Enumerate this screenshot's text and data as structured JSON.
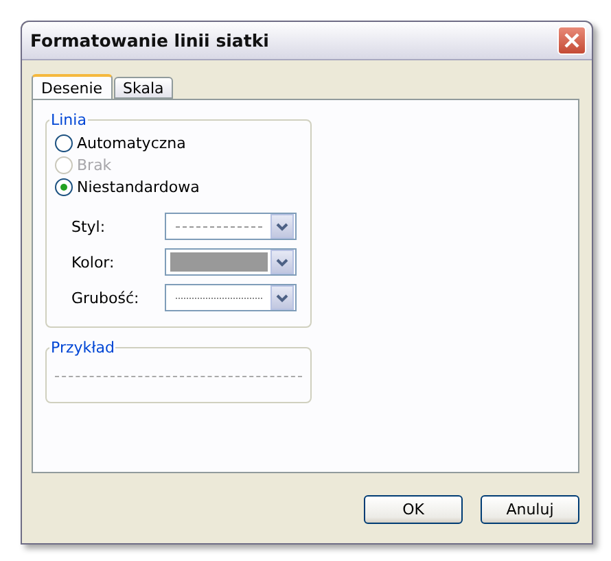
{
  "window": {
    "title": "Formatowanie linii siatki"
  },
  "tabs": [
    {
      "label": "Desenie",
      "selected": true
    },
    {
      "label": "Skala",
      "selected": false
    }
  ],
  "line_group": {
    "title": "Linia",
    "options": [
      {
        "label": "Automatyczna",
        "selected": false,
        "disabled": false
      },
      {
        "label": "Brak",
        "selected": false,
        "disabled": true
      },
      {
        "label": "Niestandardowa",
        "selected": true,
        "disabled": false
      }
    ],
    "fields": [
      {
        "label": "Styl:",
        "kind": "dashed"
      },
      {
        "label": "Kolor:",
        "kind": "color",
        "color": "#999999"
      },
      {
        "label": "Grubość:",
        "kind": "thin"
      }
    ]
  },
  "sample_group": {
    "title": "Przykład"
  },
  "buttons": [
    "OK",
    "Anuluj"
  ]
}
